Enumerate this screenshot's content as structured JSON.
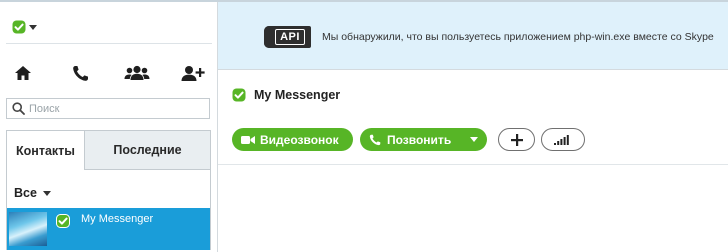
{
  "colors": {
    "accent_green": "#57b526",
    "selection_blue": "#1a9dd9",
    "banner_bg": "#dff1fb"
  },
  "sidebar": {
    "status_icon": "online-status-icon",
    "nav": [
      {
        "name": "home-icon"
      },
      {
        "name": "call-icon"
      },
      {
        "name": "group-icon"
      },
      {
        "name": "add-contact-icon"
      }
    ],
    "search": {
      "placeholder": "Поиск"
    },
    "tabs": {
      "contacts": "Контакты",
      "recent": "Последние"
    },
    "filter": {
      "label": "Все"
    },
    "contacts": [
      {
        "name": "My Messenger",
        "status": "online"
      }
    ]
  },
  "banner": {
    "badge": "API",
    "message": "Мы обнаружили, что вы пользуетесь приложением php-win.exe вместе со Skype"
  },
  "conversation": {
    "title": "My Messenger",
    "video_call_label": "Видеозвонок",
    "call_label": "Позвонить"
  }
}
